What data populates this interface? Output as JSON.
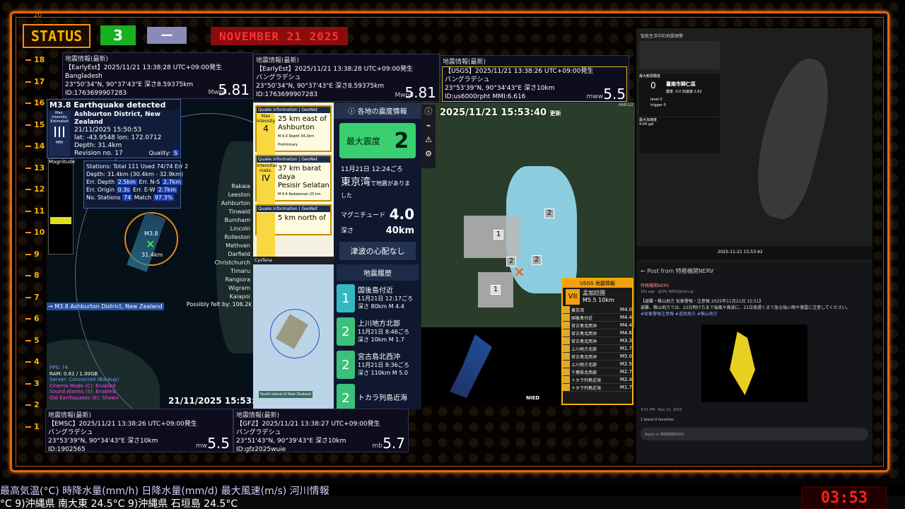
{
  "status": {
    "label": "STATUS",
    "level": "3",
    "dash": "ー",
    "date": "NOVEMBER 21 2025",
    "top_num": "20"
  },
  "scale": [
    "18",
    "17",
    "16",
    "15",
    "14",
    "13",
    "12",
    "11",
    "10",
    "9",
    "8",
    "7",
    "6",
    "5",
    "4",
    "3",
    "2",
    "1"
  ],
  "box1": {
    "head": "地震情報(最新)",
    "l1": "【EarlyEst】2025/11/21 13:38:28 UTC+09:00発生",
    "l2": "Bangladesh",
    "l3": "23°50'34\"N, 90°37'43\"E 深さ8.59375km",
    "l4": "ID:1763699907283",
    "mag_label": "Mwpd",
    "mag": "5.81"
  },
  "box2": {
    "head": "地震情報(最新)",
    "l1": "【EarlyEst】2025/11/21 13:38:28 UTC+09:00発生",
    "l2": "バングラデシュ",
    "l3": "23°50'34\"N, 90°37'43\"E 深さ8.59375km",
    "l4": "ID:1763699907283",
    "mag_label": "Mwpd",
    "mag": "5.81"
  },
  "box3": {
    "head": "地震情報(最新)",
    "l1": "【USGS】2025/11/21 13:38:26 UTC+09:00発生",
    "l2": "バングラデシュ",
    "l3": "23°53'39\"N, 90°34'43\"E 深さ10km",
    "l4": "ID:us6000rpht MMI:6.616",
    "mag_label": "mww",
    "mag": "5.5"
  },
  "box4": {
    "head": "地震情報(最新)",
    "l1": "【EMSC】2025/11/21 13:38:26 UTC+09:00発生",
    "l2": "バングラデシュ",
    "l3": "23°53'39\"N, 90°34'43\"E 深さ10km",
    "l4": "ID:1902565",
    "mag_label": "mw",
    "mag": "5.5"
  },
  "box5": {
    "head": "地震情報(最新)",
    "l1": "【GFZ】2025/11/21 13:38:27 UTC+09:00発生",
    "l2": "バングラデシュ",
    "l3": "23°51'43\"N, 90°39'43\"E 深さ10km",
    "l4": "ID:gfz2025wuie",
    "mag_label": "mb",
    "mag": "5.7"
  },
  "nz": {
    "title": "M3.8 Earthquake detected",
    "max_int_label": "Max. Intensity Estimated",
    "max_int": "III",
    "mmi": "MMI",
    "place": "Ashburton District, New Zealand",
    "time": "21/11/2025 15:50:53",
    "latlon": "lat: -43.9548 lon: 172.0712",
    "depth": "Depth: 31.4km",
    "revision": "Revision no. 17",
    "quality_label": "Quality:",
    "quality": "S",
    "magnitude_label": "Magnitude",
    "stations": "Stations: Total 111 Used 74/74 Err 2",
    "depth2": "Depth: 31.4km (30.4km - 32.9km)",
    "err_depth_label": "Err. Depth",
    "err_depth": "2.5km",
    "err_ns_label": "Err. N-S",
    "err_ns": "2.7km",
    "err_origin_label": "Err. Origin",
    "err_origin": "0.3s",
    "err_ew_label": "Err. E-W",
    "err_ew": "2.7km",
    "nostations_label": "No. Stations",
    "nostations": "74",
    "match_label": "Match",
    "match": "97.3%",
    "places": [
      "Rakaia",
      "Leeston",
      "Ashburton",
      "Tinwald",
      "Burnham",
      "Lincoln",
      "Rolleston",
      "Methven",
      "Darfield",
      "Christchurch",
      "Timaru",
      "Rangiora",
      "Wigram",
      "Kaiapoi"
    ],
    "felt": "Possibly felt by: 106.2k",
    "epi_mag": "M3.8",
    "epi_depth": "31.4km",
    "footer_alert": "→ M3.8 Ashburton District, New Zealand",
    "stats": [
      "FPS: 74",
      "RAM: 0.61 / 1.00GB",
      "Server: Connected (Backup)",
      "Cinema Mode (C): Enabled",
      "Sound Alarms (S): Enabled",
      "Old Earthquakes (E): Shown"
    ],
    "clock": "21/11/2025 15:53:45"
  },
  "quake_cards": [
    {
      "head": "Quake information | GeoNet",
      "int_label": "Max intensity",
      "int": "4",
      "l1": "25 km east of",
      "l2": "Ashburton",
      "meta": "M 4.0  Depth 34.2km  Preliminary"
    },
    {
      "head": "Quake information | GeoNet",
      "int_label": "intensitas maks.",
      "int": "IV",
      "l1": "37 km barat daya",
      "l2": "Pesisir Selatan",
      "meta": "M 4.4  Kedalaman 25 km"
    },
    {
      "head": "Quake information | GeoNet",
      "int_label": "",
      "int": "",
      "l1": "5 km north of",
      "l2": "",
      "meta": ""
    }
  ],
  "nz_small_map": {
    "tab": "CysTena",
    "label": "South Island of New Zealand"
  },
  "jp": {
    "header": "各地の震度情報",
    "max_label": "最大震度",
    "max": "2",
    "time": "11月21日 12:24ごろ",
    "region": "東京湾",
    "region_suffix": "で地震がありました",
    "mag_label": "マグニチュード",
    "mag": "4.0",
    "depth_label": "深さ",
    "depth": "40km",
    "tsunami": "津波の心配なし",
    "history_header": "地震履歴",
    "history": [
      {
        "int": "1",
        "place": "国後島付近",
        "time": "11月21日 12:17ごろ",
        "depth": "深さ 80km",
        "mag": "M 4.4"
      },
      {
        "int": "2",
        "place": "上川地方北部",
        "time": "11月21日 8:46ごろ",
        "depth": "深さ 10km",
        "mag": "M 1.7"
      },
      {
        "int": "2",
        "place": "宮古島北西沖",
        "time": "11月21日 8:36ごろ",
        "depth": "深さ 110km",
        "mag": "M 5.0"
      },
      {
        "int": "2",
        "place": "トカラ列島近海",
        "time": "",
        "depth": "",
        "mag": ""
      }
    ]
  },
  "kanto": {
    "time": "2025/11/21 15:53:40",
    "updated": "更新",
    "corner": "6681/2",
    "labels": [
      "2",
      "1",
      "2",
      "2",
      "1"
    ]
  },
  "usgs": {
    "title": "USGS 地震情報",
    "mmi": "VII",
    "place": "孟加拉国",
    "mag": "M5.5",
    "depth": "10km",
    "rows": [
      {
        "place": "東京湾",
        "mag": "M4.0"
      },
      {
        "place": "国後島付近",
        "mag": "M4.4"
      },
      {
        "place": "宮古島北西沖",
        "mag": "M4.4"
      },
      {
        "place": "宮古島北西沖",
        "mag": "M4.6"
      },
      {
        "place": "宮古島北西沖",
        "mag": "M3.3"
      },
      {
        "place": "上川地方北部",
        "mag": "M1.7"
      },
      {
        "place": "宮古島北西沖",
        "mag": "M5.0"
      },
      {
        "place": "上川地方北部",
        "mag": "M2.5"
      },
      {
        "place": "千葉県北西部",
        "mag": "M2.7"
      },
      {
        "place": "トカラ列島近海",
        "mag": "M2.4"
      },
      {
        "place": "トカラ列島近海",
        "mag": "M1.7"
      }
    ]
  },
  "nied": {
    "label": "NIED"
  },
  "taiwan": {
    "title": "智能生活中的地震預警",
    "level_label": "最大観測震度",
    "level": "0",
    "place": "臺南市歸仁區",
    "sub": "震度 -3.0  加速度 2.62",
    "stat1": "level 0",
    "stat2": "trigger 0",
    "max_acc_label": "最大加速度",
    "max_acc": "4.04 gal",
    "timestamp": "2025-11-21 15:53:42"
  },
  "nerv": {
    "back": "Post from 特務機関NERV",
    "name": "特務機関NERV",
    "handle": "10s ago · @UN_NERV@nerv.jp",
    "body": "【避難・稚山地方 気象警報・注意報 2025年11月21日 15:51】",
    "body2": "避難、稚山地方では、22日明け方まで強風や高波に、21日夜遅くまで急な強い雨や落雷に注意してください。",
    "tags": "#気象警報注意報 #道南地方 #稚山地方",
    "time": "3:51 PM · Nov 21, 2025",
    "stats": "1 boost  0 favorites",
    "reply": "Reply to 特務機関NERV"
  },
  "ticker": {
    "top": "最高気温(°C) 時降水量(mm/h)   日降水量(mm/d)   最大風速(m/s)   河川情報",
    "bottom": "°C   9)沖縄県 南大東 24.5°C     9)沖縄県 石垣島 24.5°C",
    "clock": "03:53"
  }
}
